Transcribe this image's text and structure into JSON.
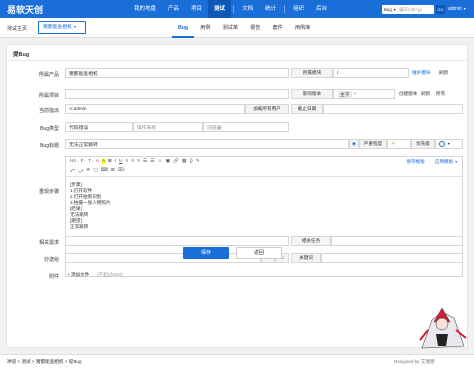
{
  "brand": "易软天创",
  "nav": [
    {
      "label": "我的地盘",
      "active": false
    },
    {
      "label": "产品",
      "active": false
    },
    {
      "label": "项目",
      "active": false
    },
    {
      "label": "测试",
      "active": true
    },
    {
      "label": "文档",
      "active": false
    },
    {
      "label": "统计",
      "active": false
    },
    {
      "label": "组织",
      "active": false
    },
    {
      "label": "后台",
      "active": false
    }
  ],
  "search": {
    "scope": "Bug",
    "placeholder": "编号(ctrl+g)",
    "go": "GO"
  },
  "user": "admin",
  "crumb": {
    "home": "测试主页",
    "product": "猪都能查相机"
  },
  "subtabs": [
    {
      "label": "Bug",
      "active": true
    },
    {
      "label": "用例",
      "active": false
    },
    {
      "label": "测试单",
      "active": false
    },
    {
      "label": "报告",
      "active": false
    },
    {
      "label": "套件",
      "active": false
    },
    {
      "label": "用例库",
      "active": false
    }
  ],
  "form": {
    "title": "提Bug",
    "product_label": "所属产品",
    "product_value": "猪都能查相机",
    "module_label": "所属模块",
    "module_value": "/",
    "maintain_module": "维护模块",
    "refresh": "刷新",
    "project_label": "所属项目",
    "project_value": "",
    "version_label": "影响版本",
    "version_value": "主干",
    "create_version": "创建版本",
    "all": "所有",
    "assign_label": "当前指派",
    "assign_value": "A:admin",
    "load_all_users": "加载所有用户",
    "deadline_label": "截止日期",
    "type_label": "Bug类型",
    "type_value": "代码错误",
    "os_placeholder": "操作系统",
    "browser_placeholder": "浏览器",
    "bugtitle_label": "Bug标题",
    "bugtitle_value": "无法正常跳转",
    "severity_label": "严重程度",
    "priority_label": "优先级",
    "steps_label": "重现步骤",
    "toolbar_row1": [
      "H1·",
      "F·",
      "T·",
      "A",
      "A",
      "B",
      "I",
      "U",
      "≡",
      "≡",
      "≡",
      "☰",
      "☰",
      "☺",
      "▣",
      "🔗",
      "▦",
      "{}",
      "✎"
    ],
    "toolbar_row2": [
      "⤺",
      "⤻",
      "⊘",
      "▢",
      "⌨",
      "⊞",
      "⌦"
    ],
    "save_template": "保存模板",
    "apply_template": "应用模板",
    "steps_text": [
      "[步骤]",
      "1.打开软件",
      "2.打开拍照识别",
      "3.拍摄一张人物照片",
      "[结果]",
      "无法跳转",
      "[期望]",
      "正常跳转"
    ],
    "story_label": "相关需求",
    "task_label": "相关任务",
    "cc_label": "抄送给",
    "keywords_label": "关键词",
    "attach_label": "附件",
    "add_file": "添加文件",
    "file_limit": "(不超过50M)",
    "save": "保存",
    "back": "返回"
  },
  "footer": {
    "crumbs": [
      "禅道",
      "测试",
      "猪都能查相机",
      "提Bug"
    ],
    "designed": "Designed by 艾瑞德"
  }
}
